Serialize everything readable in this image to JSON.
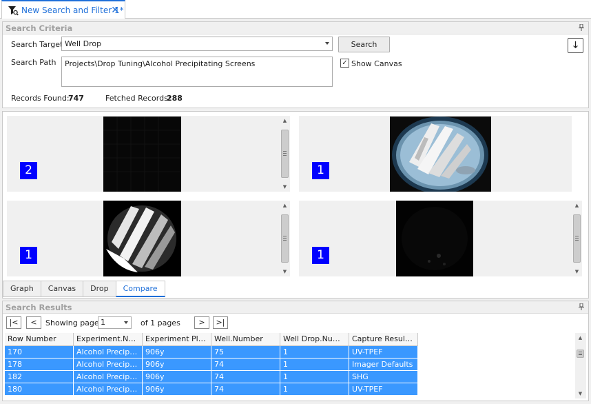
{
  "tab": {
    "title": "New Search and Filter 1*",
    "close": "✕"
  },
  "criteria": {
    "header": "Search Criteria",
    "search_target_label": "Search Target",
    "search_target_value": "Well Drop",
    "search_path_label": "Search Path",
    "search_path_value": "Projects\\Drop Tuning\\Alcohol Precipitating Screens",
    "search_button": "Search",
    "show_canvas_label": "Show Canvas",
    "show_canvas_checked": "✓",
    "records_found_label": "Records Found:",
    "records_found_value": "747",
    "fetched_label": "Fetched Records:",
    "fetched_value": "288",
    "down_arrow": "🡓"
  },
  "compare": {
    "cells": [
      {
        "badge": "2"
      },
      {
        "badge": "1"
      },
      {
        "badge": "1"
      },
      {
        "badge": "1"
      }
    ],
    "scroll_up": "▲",
    "scroll_down": "▼"
  },
  "bottom_tabs": [
    "Graph",
    "Canvas",
    "Drop",
    "Compare"
  ],
  "results": {
    "header": "Search Results",
    "first_btn": "|<",
    "prev_btn": "<",
    "next_btn": ">",
    "last_btn": ">|",
    "showing_label": "Showing page",
    "page_value": "1",
    "of_pages": "of 1 pages",
    "columns": [
      "Row Number",
      "Experiment.Name",
      "Experiment Plat...",
      "Well.Number",
      "Well Drop.Number",
      "Capture Result...."
    ],
    "rows": [
      [
        "170",
        "Alcohol Precipita...",
        "906y",
        "75",
        "1",
        "UV-TPEF"
      ],
      [
        "178",
        "Alcohol Precipita...",
        "906y",
        "74",
        "1",
        "Imager Defaults"
      ],
      [
        "182",
        "Alcohol Precipita...",
        "906y",
        "74",
        "1",
        "SHG"
      ],
      [
        "180",
        "Alcohol Precipita...",
        "906y",
        "74",
        "1",
        "UV-TPEF"
      ]
    ]
  }
}
